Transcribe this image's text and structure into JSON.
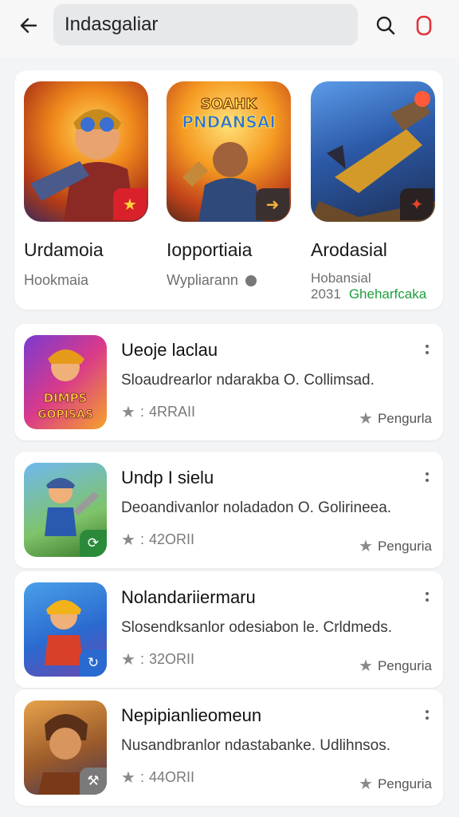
{
  "search": {
    "query": "Indasgaliar"
  },
  "featured": [
    {
      "title": "Urdamoia",
      "subtitle": "Hookmaia",
      "badge": "spark-icon",
      "art_text": ""
    },
    {
      "title": "Iopportiaia",
      "subtitle": "Wypliarann",
      "badge": "arrow-icon",
      "art_text": "SOAHK PNDANSAI"
    },
    {
      "title": "Arodasial",
      "subtitle": "Hobansial",
      "year": "2031",
      "tag": "Gheharfcaka",
      "badge": "blaster-icon",
      "art_text": ""
    }
  ],
  "apps": [
    {
      "title": "Ueoje laclau",
      "description": "Sloaudrearlor ndarakba O. Collimsad.",
      "rating": "4RRAII",
      "category": "Pengurla",
      "art_text": "DIMPS GOPISAS"
    },
    {
      "title": "Undp I sielu",
      "description": "Deoandivanlor noladadon O. Golirineea.",
      "rating": "42ОRII",
      "category": "Penguria",
      "art_text": ""
    },
    {
      "title": "Nolandariiermaru",
      "description": "Slosendksanlor odesiabon le. Crldmeds.",
      "rating": "32ОRII",
      "category": "Penguria",
      "art_text": ""
    },
    {
      "title": "Nepipianlieomeun",
      "description": "Nusandbranlor ndastabanke. Udlihnsos.",
      "rating": "44ОRII",
      "category": "Penguria",
      "art_text": ""
    }
  ],
  "colors": {
    "accent_red": "#e0333a",
    "rating_green": "#1e9e3e"
  }
}
